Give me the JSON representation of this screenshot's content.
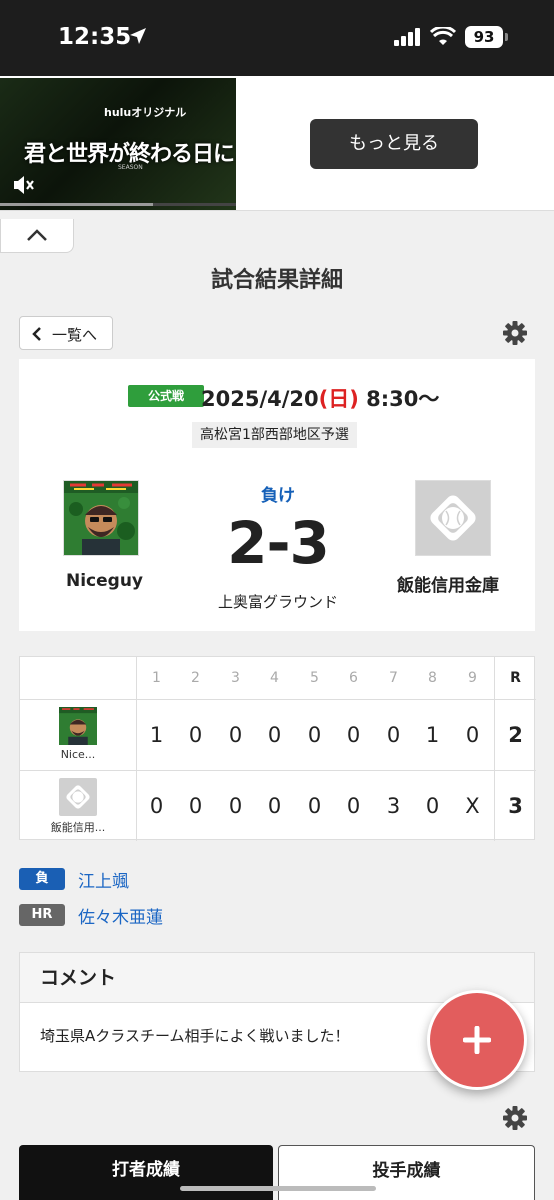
{
  "status_bar": {
    "time": "12:35",
    "battery": "93"
  },
  "ad": {
    "brand": "huluオリジナル",
    "title": "君と世界が終わる日に",
    "season": "SEASON",
    "button": "もっと見る",
    "progress": 0.65
  },
  "page_title": "試合結果詳細",
  "back_button": "一覧へ",
  "game": {
    "type_badge": "公式戦",
    "date_prefix": "2025/4/20",
    "day_of_week": "(日)",
    "time": "8:30〜",
    "tournament": "高松宮1部西部地区予選",
    "home_team": "Niceguy",
    "away_team": "飯能信用金庫",
    "result": "負け",
    "score": "2-3",
    "ground": "上奥富グラウンド"
  },
  "linescore": {
    "innings": [
      "1",
      "2",
      "3",
      "4",
      "5",
      "6",
      "7",
      "8",
      "9"
    ],
    "total_label": "R",
    "rows": [
      {
        "team": "Nice...",
        "scores": [
          "1",
          "0",
          "0",
          "0",
          "0",
          "0",
          "0",
          "1",
          "0"
        ],
        "total": "2"
      },
      {
        "team": "飯能信用...",
        "scores": [
          "0",
          "0",
          "0",
          "0",
          "0",
          "0",
          "3",
          "0",
          "X"
        ],
        "total": "3"
      }
    ]
  },
  "decisions": [
    {
      "label": "負",
      "player": "江上颯",
      "color": "#1a5fb4"
    },
    {
      "label": "HR",
      "player": "佐々木亜蓮",
      "color": "#666666"
    }
  ],
  "comment": {
    "heading": "コメント",
    "text": "埼玉県Aクラスチーム相手によく戦いました！"
  },
  "tabs": {
    "batting": "打者成績",
    "pitching": "投手成績"
  }
}
